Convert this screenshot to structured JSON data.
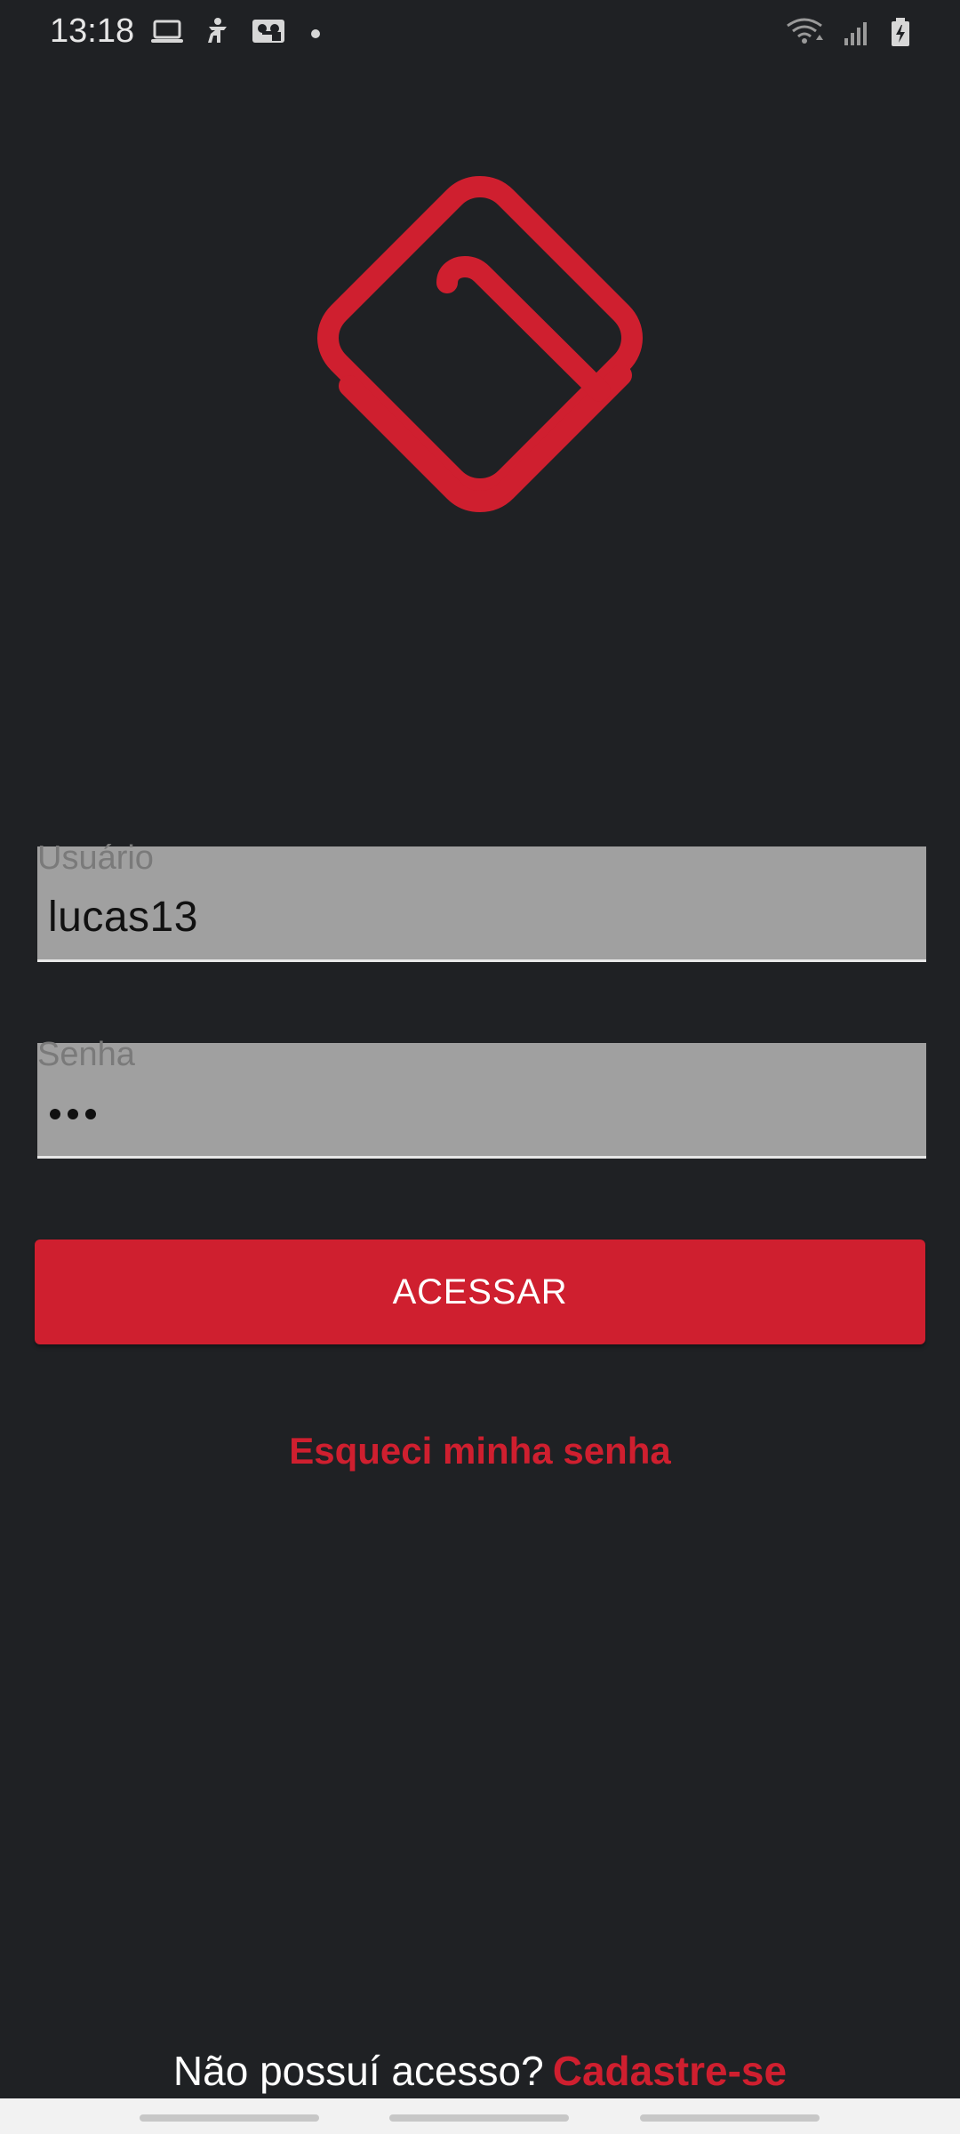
{
  "status_bar": {
    "time": "13:18",
    "left_icons": [
      "laptop-icon",
      "accessibility-icon",
      "voicemail-icon",
      "dot-icon"
    ],
    "right_icons": [
      "wifi-icon",
      "signal-icon",
      "battery-charging-icon"
    ]
  },
  "logo": {
    "icon": "brand-logo-icon",
    "color": "#cf1f2f"
  },
  "form": {
    "username_label": "Usuário",
    "username_value": "lucas13",
    "password_label": "Senha",
    "password_masked": "•••"
  },
  "buttons": {
    "acessar": "ACESSAR",
    "forgot_password": "Esqueci minha senha"
  },
  "footer": {
    "no_access_text": "Não possuí acesso?",
    "signup_link": "Cadastre-se"
  },
  "colors": {
    "background": "#1f2124",
    "accent": "#cf1f2f",
    "field_background": "#a0a0a0"
  }
}
